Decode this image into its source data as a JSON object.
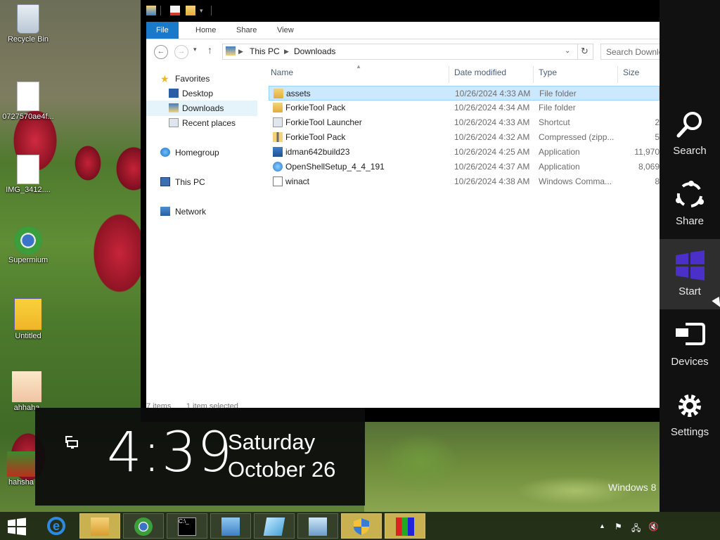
{
  "desktop": {
    "icons": [
      {
        "label": "Recycle Bin"
      },
      {
        "label": "0727570ae4f..."
      },
      {
        "label": "IMG_3412...."
      },
      {
        "label": "Supermium"
      },
      {
        "label": "Untitled"
      },
      {
        "label": "ahhaha"
      },
      {
        "label": "hahsha"
      }
    ],
    "watermark": "Windows 8"
  },
  "explorer": {
    "ribbon_tabs": [
      "File",
      "Home",
      "Share",
      "View"
    ],
    "address": {
      "segments": [
        "This PC",
        "Downloads"
      ]
    },
    "search_placeholder": "Search Downloads",
    "nav": {
      "favorites": "Favorites",
      "desktop": "Desktop",
      "downloads": "Downloads",
      "recent": "Recent places",
      "homegroup": "Homegroup",
      "this_pc": "This PC",
      "network": "Network"
    },
    "columns": {
      "name": "Name",
      "date": "Date modified",
      "type": "Type",
      "size": "Size"
    },
    "files": [
      {
        "name": "assets",
        "date": "10/26/2024 4:33 AM",
        "type": "File folder",
        "size": "",
        "icon": "folder-icon",
        "selected": true
      },
      {
        "name": "ForkieTool Pack",
        "date": "10/26/2024 4:34 AM",
        "type": "File folder",
        "size": "",
        "icon": "folder-icon",
        "selected": false
      },
      {
        "name": "ForkieTool Launcher",
        "date": "10/26/2024 4:33 AM",
        "type": "Shortcut",
        "size": "2",
        "icon": "shortcut-icon",
        "selected": false
      },
      {
        "name": "ForkieTool Pack",
        "date": "10/26/2024 4:32 AM",
        "type": "Compressed (zipp...",
        "size": "5",
        "icon": "zip-icon",
        "selected": false
      },
      {
        "name": "idman642build23",
        "date": "10/26/2024 4:25 AM",
        "type": "Application",
        "size": "11,970",
        "icon": "app-icon",
        "selected": false
      },
      {
        "name": "OpenShellSetup_4_4_191",
        "date": "10/26/2024 4:37 AM",
        "type": "Application",
        "size": "8,069",
        "icon": "globe-icon",
        "selected": false
      },
      {
        "name": "winact",
        "date": "10/26/2024 4:38 AM",
        "type": "Windows Comma...",
        "size": "8",
        "icon": "cmd-icon",
        "selected": false
      }
    ],
    "status": {
      "items": "7 items",
      "selected": "1 item selected"
    }
  },
  "clock": {
    "time": "4:39",
    "day": "Saturday",
    "date": "October 26"
  },
  "charms": [
    "Search",
    "Share",
    "Start",
    "Devices",
    "Settings"
  ],
  "colors": {
    "accent": "#1979ca",
    "start_charm": "#4b2fc9",
    "selection": "#cce8ff"
  }
}
